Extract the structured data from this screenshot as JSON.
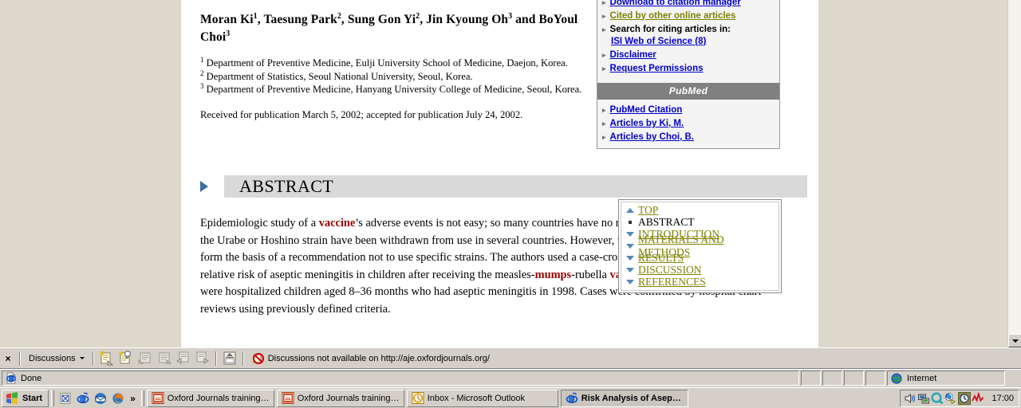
{
  "article": {
    "authors_html": "Moran Ki<sup>1</sup>, Taesung Park<sup>2</sup>, Sung Gon Yi<sup>2</sup>, Jin Kyoung Oh<sup>3</sup> and BoYoul Choi<sup>3</sup>",
    "affiliations": [
      {
        "sup": "1",
        "text": "Department of Preventive Medicine, Eulji University School of Medicine, Daejon, Korea."
      },
      {
        "sup": "2",
        "text": "Department of Statistics, Seoul National University, Seoul, Korea."
      },
      {
        "sup": "3",
        "text": "Department of Preventive Medicine, Hanyang University College of Medicine, Seoul, Korea."
      }
    ],
    "received": "Received for publication March 5, 2002; accepted for publication July 24, 2002.",
    "abstract_heading": "ABSTRACT",
    "abstract_html": "Epidemiologic study of a <b class=\"kw\">vaccine</b>’s adverse events is not easy; so many countries have no reliable data. <b class=\"kw\">Vaccines</b> containing the Urabe or Hoshino strain have been withdrawn from use in several countries. However, the data are not strong enough to form the basis of a recommendation not to use specific strains. The authors used a case-crossover design to estimate the relative risk of aseptic meningitis in children after receiving the measles-<b class=\"kw\">mumps</b>-rubella <b class=\"kw\">vaccine</b> in Korea. Study subjects were hospitalized children aged 8–36 months who had aseptic meningitis in 1998. Cases were confirmed by hospital chart reviews using previously defined criteria."
  },
  "sidebar": {
    "items": [
      {
        "label": "Download to citation manager",
        "style": "link",
        "bullet": "▸"
      },
      {
        "label": "Cited by other online articles",
        "style": "visited",
        "bullet": "▸"
      },
      {
        "label": "Search for citing articles in:",
        "style": "plain",
        "bullet": "▸",
        "sub": "ISI Web of Science (8)"
      },
      {
        "label": "Disclaimer",
        "style": "link",
        "bullet": "▸"
      },
      {
        "label": "Request Permissions",
        "style": "link",
        "bullet": "▸"
      }
    ],
    "pubmed_header": "PubMed",
    "pubmed_items": [
      {
        "label": "PubMed Citation",
        "style": "link",
        "bullet": "▸"
      },
      {
        "label": "Articles by Ki, M.",
        "style": "link",
        "bullet": "▸"
      },
      {
        "label": "Articles by Choi, B.",
        "style": "link",
        "bullet": "▸"
      }
    ]
  },
  "toc": {
    "items": [
      {
        "label": "TOP",
        "mark": "up",
        "current": false
      },
      {
        "label": "ABSTRACT",
        "mark": "square",
        "current": true
      },
      {
        "label": "INTRODUCTION",
        "mark": "down",
        "current": false
      },
      {
        "label": "MATERIALS AND METHODS",
        "mark": "down",
        "current": false
      },
      {
        "label": "RESULTS",
        "mark": "down",
        "current": false
      },
      {
        "label": "DISCUSSION",
        "mark": "down",
        "current": false
      },
      {
        "label": "REFERENCES",
        "mark": "down",
        "current": false
      }
    ]
  },
  "discussions_bar": {
    "close_label": "×",
    "menu_label": "Discussions",
    "status_text": "Discussions not available on http://aje.oxfordjournals.org/",
    "icons": [
      "insert-discussion-in-document-icon",
      "insert-discussion-about-document-icon",
      "previous-discussion-icon",
      "next-discussion-icon",
      "show-discussion-pane-icon",
      "refresh-discussion-icon",
      "subscribe-icon"
    ]
  },
  "status_bar": {
    "main_text": "Done",
    "zone_text": "Internet",
    "doc_icon": "ie-page-icon",
    "zone_icon": "globe-icon"
  },
  "taskbar": {
    "start_label": "Start",
    "quicklaunch": [
      "show-desktop-icon",
      "internet-explorer-icon",
      "outlook-express-icon",
      "firefox-icon"
    ],
    "quicklaunch_more": "»",
    "tasks": [
      {
        "label": "Oxford Journals training …",
        "icon": "powerpoint-icon",
        "active": false
      },
      {
        "label": "Oxford Journals training …",
        "icon": "powerpoint-icon",
        "active": false
      },
      {
        "label": "Inbox - Microsoft Outlook",
        "icon": "outlook-icon",
        "active": false
      },
      {
        "label": "Risk Analysis of Asepti…",
        "icon": "internet-explorer-icon",
        "active": true
      }
    ],
    "tray_icons": [
      "volume-icon",
      "network-icon",
      "antivirus-icon",
      "update-icon",
      "clock-tray-icon",
      "activity-icon"
    ],
    "clock": "17:00"
  },
  "colors": {
    "page_background": "#dcd9cc",
    "content_background": "#ffffff",
    "link": "#0000cc",
    "visited_link": "#808000",
    "keyword": "#990000",
    "section_bar": "#d9d9d9",
    "pubmed_bar": "#808080",
    "chrome": "#d4d0c8"
  }
}
